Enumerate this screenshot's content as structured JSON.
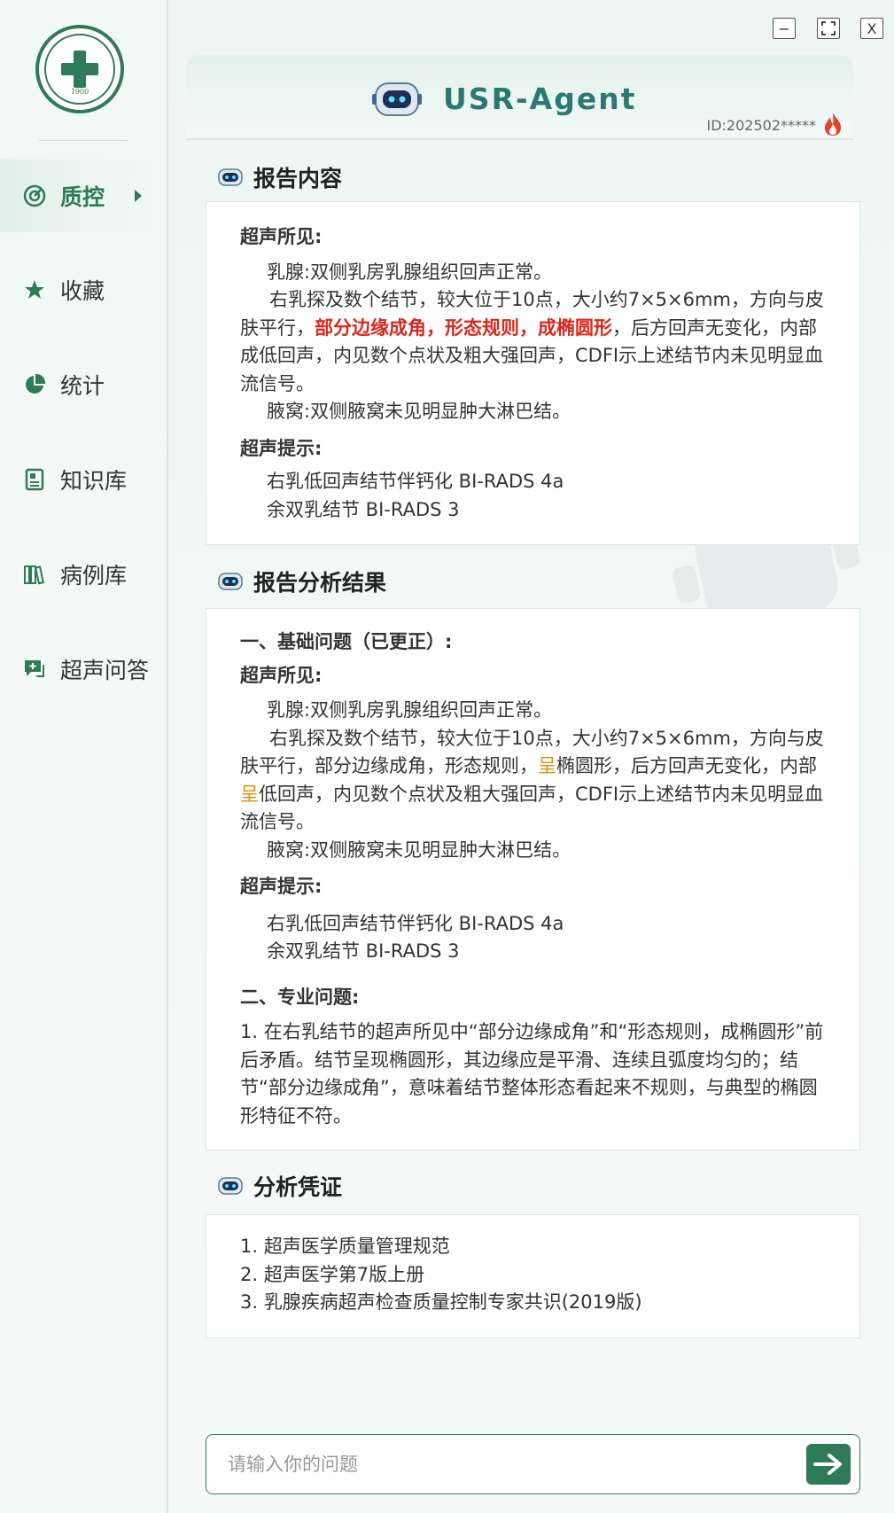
{
  "app": {
    "title": "USR-Agent",
    "id_label": "ID:202502*****",
    "brand_color": "#2f7a57",
    "title_color": "#2a7a72",
    "logo_year": "1900"
  },
  "window_controls": {
    "minimize": "−",
    "maximize": "⛶",
    "close": "X"
  },
  "sidebar": {
    "items": [
      {
        "label": "质控",
        "icon": "target-icon",
        "active": true
      },
      {
        "label": "收藏",
        "icon": "star-icon",
        "active": false
      },
      {
        "label": "统计",
        "icon": "pie-chart-icon",
        "active": false
      },
      {
        "label": "知识库",
        "icon": "document-icon",
        "active": false
      },
      {
        "label": "病例库",
        "icon": "books-icon",
        "active": false
      },
      {
        "label": "超声问答",
        "icon": "chat-plus-icon",
        "active": false
      }
    ]
  },
  "report": {
    "title": "报告内容",
    "findings_label": "超声所见:",
    "line1": "乳腺:双侧乳房乳腺组织回声正常。",
    "line2_a": " 右乳探及数个结节，较大位于10点，大小约7×5×6mm，方向与皮肤平行，",
    "line2_red": "部分边缘成角，形态规则，成椭圆形",
    "line2_b": "，后方回声无变化，内部成低回声，内见数个点状及粗大强回声，CDFI示上述结节内未见明显血流信号。",
    "line3": "腋窝:双侧腋窝未见明显肿大淋巴结。",
    "hint_label": "超声提示:",
    "hint1": "右乳低回声结节伴钙化 BI-RADS 4a",
    "hint2": "余双乳结节 BI-RADS 3"
  },
  "analysis": {
    "title": "报告分析结果",
    "basic_label": "一、基础问题（已更正）:",
    "findings_label": "超声所见:",
    "line1": "乳腺:双侧乳房乳腺组织回声正常。",
    "line2_a": " 右乳探及数个结节，较大位于10点，大小约7×5×6mm，方向与皮肤平行，部分边缘成角，形态规则，",
    "line2_hl1": "呈",
    "line2_b": "椭圆形，后方回声无变化，内部",
    "line2_hl2": "呈",
    "line2_c": "低回声，内见数个点状及粗大强回声，CDFI示上述结节内未见明显血流信号。",
    "line3": "腋窝:双侧腋窝未见明显肿大淋巴结。",
    "hint_label": "超声提示:",
    "hint1": "右乳低回声结节伴钙化 BI-RADS 4a",
    "hint2": "余双乳结节 BI-RADS 3",
    "pro_label": "二、专业问题:",
    "pro1": "1. 在右乳结节的超声所见中“部分边缘成角”和“形态规则，成椭圆形”前后矛盾。结节呈现椭圆形，其边缘应是平滑、连续且弧度均匀的；结节“部分边缘成角”，意味着结节整体形态看起来不规则，与典型的椭圆形特征不符。"
  },
  "evidence": {
    "title": "分析凭证",
    "items": [
      "1. 超声医学质量管理规范",
      "2. 超声医学第7版上册",
      "3. 乳腺疾病超声检查质量控制专家共识(2019版)"
    ]
  },
  "input": {
    "placeholder": "请输入你的问题",
    "value": ""
  }
}
